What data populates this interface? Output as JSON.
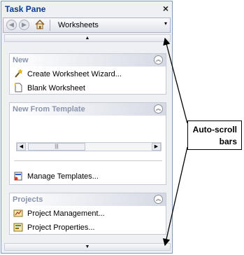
{
  "task_pane": {
    "title": "Task Pane",
    "close_glyph": "×",
    "nav": {
      "back_icon": "back-arrow-icon",
      "forward_icon": "forward-arrow-icon",
      "home_icon": "home-icon",
      "view_label": "Worksheets",
      "dropdown_glyph": "▾"
    },
    "scroll_up_glyph": "▲",
    "scroll_down_glyph": "▼",
    "sections": [
      {
        "title": "New",
        "items": [
          {
            "label": "Create Worksheet Wizard...",
            "icon": "wizard-wand-icon"
          },
          {
            "label": "Blank Worksheet",
            "icon": "blank-document-icon"
          }
        ]
      },
      {
        "title": "New From Template",
        "items": [
          {
            "label": "Manage Templates...",
            "icon": "manage-templates-icon"
          }
        ]
      },
      {
        "title": "Projects",
        "items": [
          {
            "label": "Project Management...",
            "icon": "project-management-icon"
          },
          {
            "label": "Project Properties...",
            "icon": "project-properties-icon"
          }
        ]
      }
    ]
  },
  "callout": {
    "line1": "Auto-scroll",
    "line2": "bars"
  },
  "colors": {
    "title_text": "#0b3a8c",
    "section_title": "#8a96ad",
    "pane_bg": "#eef0f4"
  }
}
